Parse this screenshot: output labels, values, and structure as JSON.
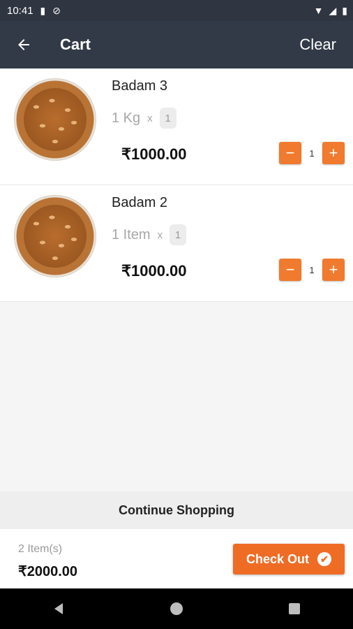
{
  "status_bar": {
    "time": "10:41"
  },
  "header": {
    "title": "Cart",
    "clear_label": "Clear"
  },
  "items": [
    {
      "name": "Badam 3",
      "unit": "1 Kg",
      "multiplier": "x",
      "unit_qty": "1",
      "price": "₹1000.00",
      "quantity": "1"
    },
    {
      "name": "Badam 2",
      "unit": "1 Item",
      "multiplier": "x",
      "unit_qty": "1",
      "price": "₹1000.00",
      "quantity": "1"
    }
  ],
  "continue_label": "Continue Shopping",
  "footer": {
    "items_count": "2 Item(s)",
    "total": "₹2000.00",
    "checkout_label": "Check Out"
  },
  "colors": {
    "accent": "#ef6c25",
    "header_bg": "#323a47"
  }
}
